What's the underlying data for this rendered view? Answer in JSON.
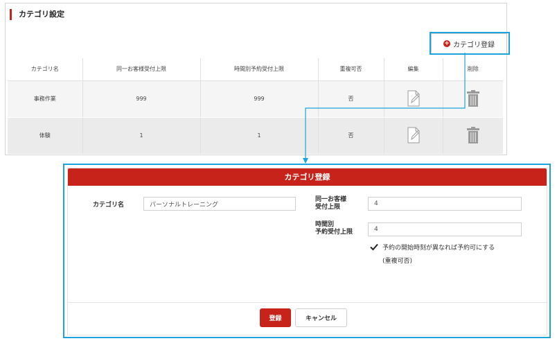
{
  "panel": {
    "title": "カテゴリ設定",
    "add_button_label": "カテゴリ登録",
    "add_button_icon": "plus-circle-icon",
    "table": {
      "headers": [
        "カテゴリ名",
        "同一お客様受付上限",
        "時間別予約受付上限",
        "重複可否",
        "編集",
        "削除"
      ],
      "rows": [
        {
          "name": "事務作業",
          "same_customer_limit": "999",
          "hourly_limit": "999",
          "duplicate": "否"
        },
        {
          "name": "体験",
          "same_customer_limit": "1",
          "hourly_limit": "1",
          "duplicate": "否"
        }
      ]
    }
  },
  "dialog": {
    "title": "カテゴリ登録",
    "category_name_label": "カテゴリ名",
    "category_name_value": "パーソナルトレーニング",
    "same_customer_label_1": "同一お客様",
    "same_customer_label_2": "受付上限",
    "same_customer_value": "4",
    "hourly_label_1": "時間別",
    "hourly_label_2": "予約受付上限",
    "hourly_value": "4",
    "checkbox_label": "予約の開始時刻が異なれば予約可にする",
    "checkbox_checked": true,
    "checkbox_note": "(重複可否)",
    "save_label": "登録",
    "cancel_label": "キャンセル"
  },
  "colors": {
    "accent": "#c8231a",
    "highlight": "#1aa3dc"
  }
}
